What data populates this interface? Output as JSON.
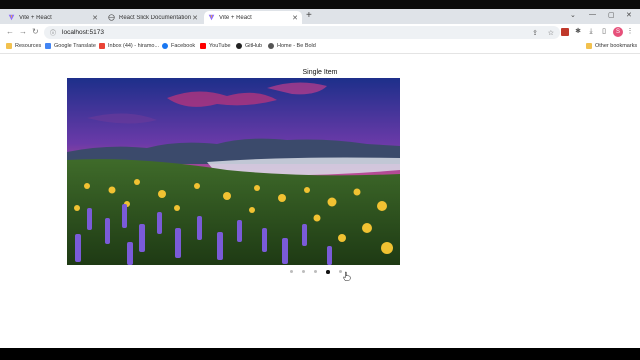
{
  "browser": {
    "tabs": [
      {
        "label": "Vite + React",
        "active": false
      },
      {
        "label": "React Slick Documentation",
        "active": false
      },
      {
        "label": "Vite + React",
        "active": true
      }
    ],
    "url": "localhost:5173",
    "bookmarks": [
      {
        "label": "Resources",
        "icon": "folder-icon"
      },
      {
        "label": "Google Translate",
        "icon": "translate-icon"
      },
      {
        "label": "Inbox (44) - hiramo...",
        "icon": "gmail-icon"
      },
      {
        "label": "Facebook",
        "icon": "facebook-icon"
      },
      {
        "label": "YouTube",
        "icon": "youtube-icon"
      },
      {
        "label": "GitHub",
        "icon": "github-icon"
      },
      {
        "label": "Home - Be Bold",
        "icon": "globe-icon"
      }
    ],
    "other_bookmarks": "Other bookmarks",
    "profile_initial": "S"
  },
  "page": {
    "title": "Single Item",
    "slider": {
      "image": "landscape-flowers-sunset",
      "dot_count": 5,
      "active_dot": 4
    }
  },
  "colors": {
    "accent_profile": "#e6507a",
    "active_dot": "#111111",
    "inactive_dot": "#bdbdbd"
  }
}
